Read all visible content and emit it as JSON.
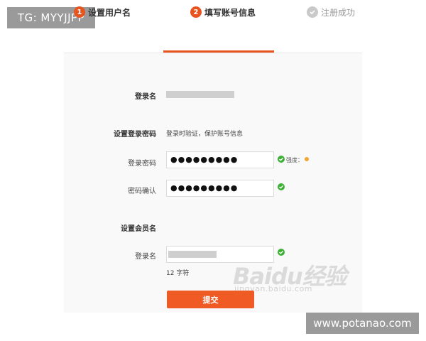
{
  "badges": {
    "tg": "TG: MYYJJPP",
    "site": "www.potanao.com"
  },
  "steps": [
    {
      "num": "1",
      "label": "设置用户名",
      "state": "done"
    },
    {
      "num": "2",
      "label": "填写账号信息",
      "state": "active"
    },
    {
      "label": "注册成功",
      "state": "pending",
      "icon": "check-circle-icon"
    }
  ],
  "form": {
    "login_name_label": "登录名",
    "password_section_label": "设置登录密码",
    "password_section_hint": "登录时验证，保护账号信息",
    "password_label": "登录密码",
    "password_value": "●●●●●●●●●",
    "strength_label": "强度：",
    "confirm_label": "密码确认",
    "confirm_value": "●●●●●●●●●",
    "member_section_label": "设置会员名",
    "member_name_label": "登录名",
    "member_name_hint": "12 字符",
    "submit_label": "提交"
  },
  "watermark": {
    "logo": "Baidu经验",
    "sub": "jingyan.baidu.com"
  },
  "colors": {
    "accent": "#e8541e",
    "success": "#3cb034",
    "strength": "#f3a531"
  }
}
